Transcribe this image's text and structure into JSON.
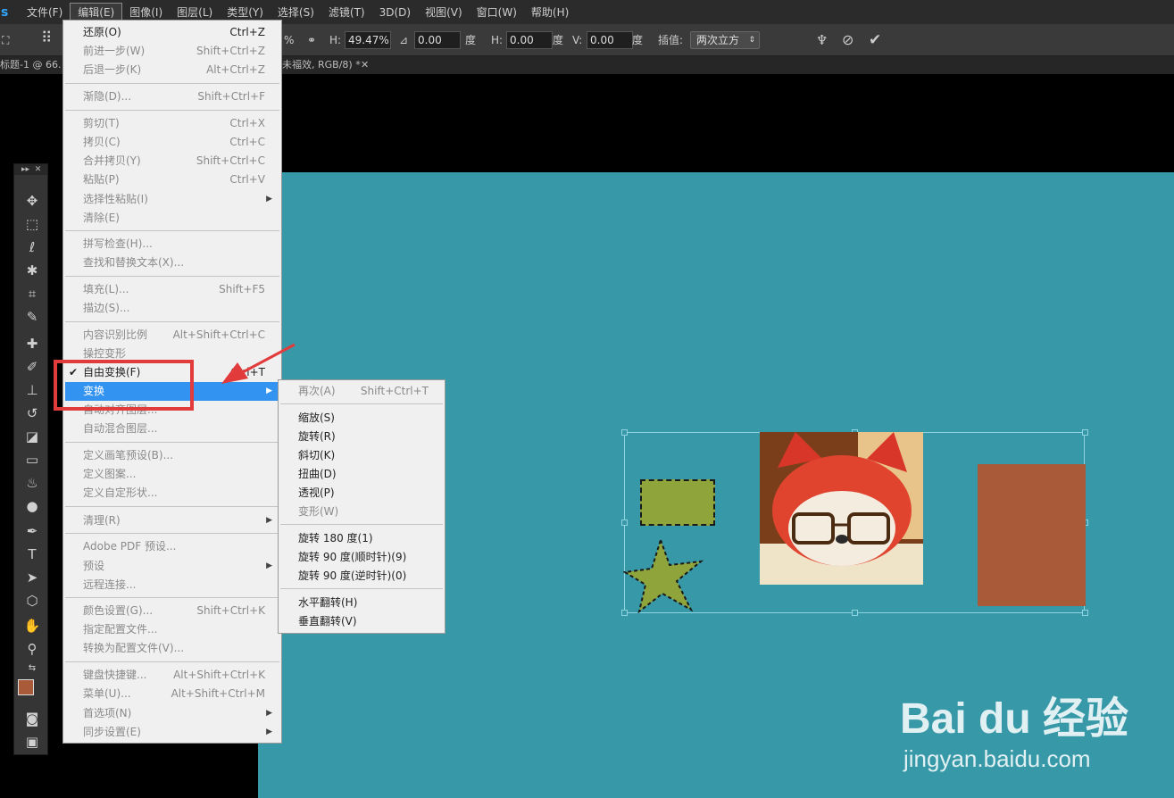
{
  "menubar": {
    "logo": "s",
    "items": [
      "文件(F)",
      "编辑(E)",
      "图像(I)",
      "图层(L)",
      "类型(Y)",
      "选择(S)",
      "滤镜(T)",
      "3D(D)",
      "视图(V)",
      "窗口(W)",
      "帮助(H)"
    ]
  },
  "options": {
    "w_suffix": "%",
    "h_label": "H:",
    "h_value": "49.47%",
    "angle_value": "0.00",
    "degree1": "度",
    "hskew_label": "H:",
    "hskew_value": "0.00",
    "degree2": "度",
    "vskew_label": "V:",
    "vskew_value": "0.00",
    "degree3": "度",
    "interp_label": "插值:",
    "interp_value": "两次立方"
  },
  "tabs": {
    "tab1": "标题-1 @ 66.",
    "tab2": "未福效, RGB/8) *"
  },
  "edit_menu": {
    "undo": {
      "label": "还原(O)",
      "shortcut": "Ctrl+Z"
    },
    "step_forward": {
      "label": "前进一步(W)",
      "shortcut": "Shift+Ctrl+Z"
    },
    "step_backward": {
      "label": "后退一步(K)",
      "shortcut": "Alt+Ctrl+Z"
    },
    "fade": {
      "label": "渐隐(D)...",
      "shortcut": "Shift+Ctrl+F"
    },
    "cut": {
      "label": "剪切(T)",
      "shortcut": "Ctrl+X"
    },
    "copy": {
      "label": "拷贝(C)",
      "shortcut": "Ctrl+C"
    },
    "copy_merged": {
      "label": "合并拷贝(Y)",
      "shortcut": "Shift+Ctrl+C"
    },
    "paste": {
      "label": "粘贴(P)",
      "shortcut": "Ctrl+V"
    },
    "paste_special": {
      "label": "选择性粘贴(I)"
    },
    "clear": {
      "label": "清除(E)"
    },
    "check_spelling": {
      "label": "拼写检查(H)..."
    },
    "find_replace": {
      "label": "查找和替换文本(X)..."
    },
    "fill": {
      "label": "填充(L)...",
      "shortcut": "Shift+F5"
    },
    "stroke": {
      "label": "描边(S)..."
    },
    "content_aware_scale": {
      "label": "内容识别比例",
      "shortcut": "Alt+Shift+Ctrl+C"
    },
    "puppet_warp": {
      "label": "操控变形"
    },
    "free_transform": {
      "label": "自由变换(F)",
      "shortcut": "Ctrl+T"
    },
    "transform": {
      "label": "变换"
    },
    "auto_align": {
      "label": "自动对齐图层..."
    },
    "auto_blend": {
      "label": "自动混合图层..."
    },
    "define_brush": {
      "label": "定义画笔预设(B)..."
    },
    "define_pattern": {
      "label": "定义图案..."
    },
    "define_shape": {
      "label": "定义自定形状..."
    },
    "purge": {
      "label": "清理(R)"
    },
    "pdf_presets": {
      "label": "Adobe PDF 预设..."
    },
    "presets": {
      "label": "预设"
    },
    "remote": {
      "label": "远程连接..."
    },
    "color_settings": {
      "label": "颜色设置(G)...",
      "shortcut": "Shift+Ctrl+K"
    },
    "assign_profile": {
      "label": "指定配置文件..."
    },
    "convert_profile": {
      "label": "转换为配置文件(V)..."
    },
    "keyboard_shortcuts": {
      "label": "键盘快捷键...",
      "shortcut": "Alt+Shift+Ctrl+K"
    },
    "menus": {
      "label": "菜单(U)...",
      "shortcut": "Alt+Shift+Ctrl+M"
    },
    "preferences": {
      "label": "首选项(N)"
    },
    "sync_settings": {
      "label": "同步设置(E)"
    }
  },
  "transform_menu": {
    "again": {
      "label": "再次(A)",
      "shortcut": "Shift+Ctrl+T"
    },
    "scale": {
      "label": "缩放(S)"
    },
    "rotate": {
      "label": "旋转(R)"
    },
    "skew": {
      "label": "斜切(K)"
    },
    "distort": {
      "label": "扭曲(D)"
    },
    "perspective": {
      "label": "透视(P)"
    },
    "warp": {
      "label": "变形(W)"
    },
    "rotate180": {
      "label": "旋转 180 度(1)"
    },
    "rotate90cw": {
      "label": "旋转 90 度(顺时针)(9)"
    },
    "rotate90ccw": {
      "label": "旋转 90 度(逆时针)(0)"
    },
    "flip_h": {
      "label": "水平翻转(H)"
    },
    "flip_v": {
      "label": "垂直翻转(V)"
    }
  },
  "watermark": {
    "logo_text": "Bai du 经验",
    "url": "jingyan.baidu.com"
  },
  "colors": {
    "canvas": "#3799a8",
    "highlight": "#3393f0",
    "annotation": "#e23b3b",
    "foreground_swatch": "#a95a38",
    "shape_green": "#8fa53c"
  }
}
